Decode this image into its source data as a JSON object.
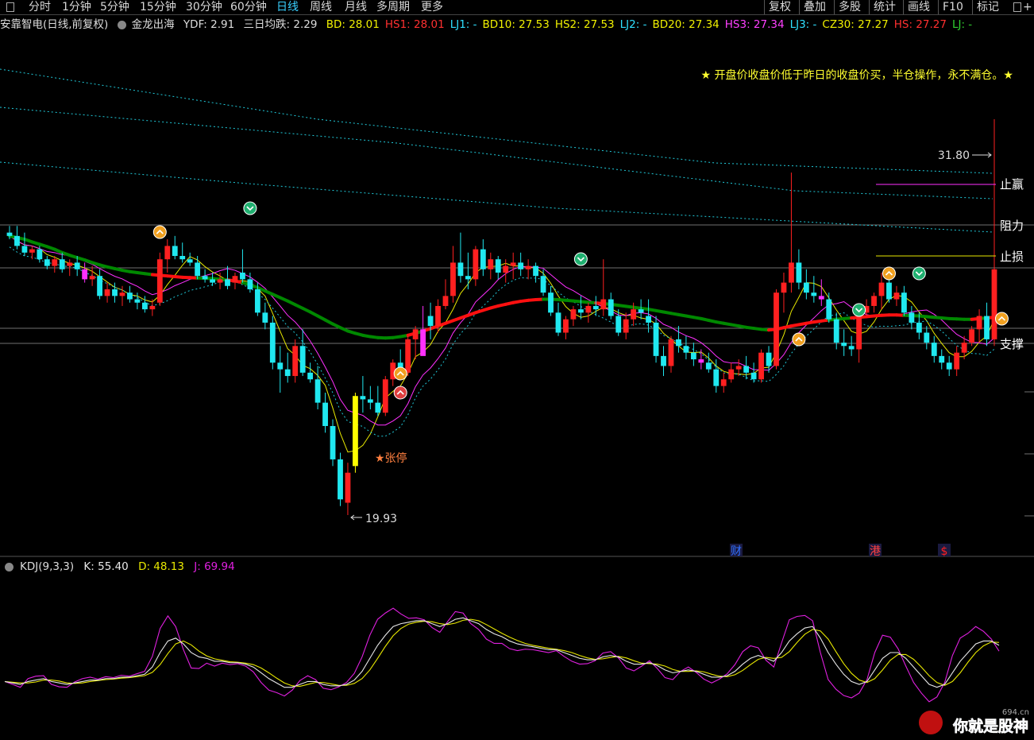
{
  "toolbar": {
    "tabs": [
      "分时",
      "1分钟",
      "5分钟",
      "15分钟",
      "30分钟",
      "60分钟",
      "日线",
      "周线",
      "月线",
      "多周期",
      "更多"
    ],
    "active_tab": "日线",
    "right_buttons": [
      "复权",
      "叠加",
      "多股",
      "统计",
      "画线",
      "F10",
      "标记",
      "+自选"
    ]
  },
  "info": {
    "stock": "安靠智电(日线,前复权)",
    "indicator": "金龙出海",
    "ydf_label": "YDF:",
    "ydf_value": "2.91",
    "sanri_label": "三日均跌:",
    "sanri_value": "2.29",
    "items": [
      {
        "text": "BD: 28.01",
        "color": "#f0f000"
      },
      {
        "text": "HS1: 28.01",
        "color": "#ff3030"
      },
      {
        "text": "LJ1: -",
        "color": "#30e0ff"
      },
      {
        "text": "BD10: 27.53",
        "color": "#f0f000"
      },
      {
        "text": "HS2: 27.53",
        "color": "#f0f000"
      },
      {
        "text": "LJ2: -",
        "color": "#30e0ff"
      },
      {
        "text": "BD20: 27.34",
        "color": "#f0f000"
      },
      {
        "text": "HS3: 27.34",
        "color": "#ff40ff"
      },
      {
        "text": "LJ3: -",
        "color": "#30e0ff"
      },
      {
        "text": "CZ30: 27.27",
        "color": "#f0f000"
      },
      {
        "text": "HS: 27.27",
        "color": "#ff3030"
      },
      {
        "text": "LJ: -",
        "color": "#30d030"
      }
    ],
    "strategy_note": "★ 开盘价收盘价低于昨日的收盘价买，半仓操作，永不满仓。★"
  },
  "kdj": {
    "name": "KDJ(9,3,3)",
    "k_text": "K: 55.40",
    "d_text": "D: 48.13",
    "j_text": "J: 69.94",
    "colors": {
      "k": "#e8e8e8",
      "d": "#e8e800",
      "j": "#e020e0"
    }
  },
  "colors": {
    "up": "#ff2020",
    "down": "#20e8f0",
    "limit_up": "#ffff00",
    "ma_green": "#008800",
    "ma_red": "#ff1010",
    "pink": "#ff30ff",
    "bg": "#000000",
    "grid": "#707070"
  },
  "chart_data": {
    "type": "candlestick",
    "annotations": {
      "high_label": "31.80",
      "low_label": "19.93",
      "limit_up_label": "★张停",
      "stop_profit_label": "止赢",
      "resistance_label": "阻力",
      "stop_loss_label": "止损",
      "support_label": "支撑",
      "event_marks": [
        "财",
        "港",
        "$"
      ],
      "watermark": "你就是股神",
      "watermark_site": "694.cn"
    },
    "price_range": [
      19.2,
      32.6
    ],
    "candles": [
      [
        28.4,
        28.6,
        28.2,
        28.3
      ],
      [
        28.3,
        28.6,
        27.9,
        28.0
      ],
      [
        28.0,
        28.4,
        27.7,
        27.8
      ],
      [
        27.8,
        28.0,
        27.6,
        27.9
      ],
      [
        27.9,
        28.0,
        27.5,
        27.6
      ],
      [
        27.6,
        27.7,
        27.3,
        27.4
      ],
      [
        27.4,
        27.7,
        27.2,
        27.6
      ],
      [
        27.6,
        27.8,
        27.2,
        27.3
      ],
      [
        27.4,
        27.6,
        27.1,
        27.5
      ],
      [
        27.5,
        27.7,
        27.1,
        27.3
      ],
      [
        27.3,
        27.5,
        26.9,
        27.0
      ],
      [
        27.0,
        27.4,
        26.8,
        27.1
      ],
      [
        27.1,
        27.3,
        26.4,
        26.5
      ],
      [
        26.5,
        26.9,
        26.3,
        26.7
      ],
      [
        26.7,
        26.9,
        26.3,
        26.5
      ],
      [
        26.5,
        26.8,
        26.2,
        26.6
      ],
      [
        26.6,
        26.8,
        26.3,
        26.4
      ],
      [
        26.4,
        26.6,
        26.1,
        26.3
      ],
      [
        26.3,
        26.5,
        26.0,
        26.1
      ],
      [
        26.1,
        26.4,
        25.9,
        26.2
      ],
      [
        26.3,
        27.8,
        26.2,
        27.6
      ],
      [
        27.6,
        28.2,
        27.2,
        28.0
      ],
      [
        28.0,
        28.3,
        27.6,
        27.7
      ],
      [
        27.7,
        28.1,
        27.5,
        27.6
      ],
      [
        27.6,
        27.8,
        27.4,
        27.5
      ],
      [
        27.5,
        27.7,
        27.0,
        27.1
      ],
      [
        27.1,
        27.3,
        26.9,
        27.0
      ],
      [
        27.0,
        27.2,
        26.8,
        26.9
      ],
      [
        26.9,
        27.2,
        26.7,
        27.0
      ],
      [
        27.0,
        27.4,
        26.7,
        26.8
      ],
      [
        26.9,
        27.2,
        26.7,
        27.1
      ],
      [
        27.2,
        27.9,
        26.9,
        27.0
      ],
      [
        27.0,
        27.2,
        26.6,
        26.7
      ],
      [
        26.7,
        26.9,
        25.9,
        26.0
      ],
      [
        26.0,
        26.3,
        25.5,
        25.7
      ],
      [
        25.7,
        25.9,
        24.3,
        24.5
      ],
      [
        24.5,
        25.0,
        23.6,
        24.3
      ],
      [
        24.3,
        24.8,
        23.9,
        24.1
      ],
      [
        24.1,
        25.2,
        23.9,
        25.0
      ],
      [
        25.0,
        25.5,
        24.1,
        24.2
      ],
      [
        24.2,
        24.5,
        23.9,
        24.0
      ],
      [
        24.0,
        24.4,
        23.1,
        23.3
      ],
      [
        23.3,
        23.6,
        22.4,
        22.6
      ],
      [
        22.6,
        22.8,
        21.4,
        21.6
      ],
      [
        21.6,
        21.8,
        20.2,
        20.4
      ],
      [
        20.3,
        21.5,
        19.93,
        21.2
      ],
      [
        21.4,
        23.6,
        21.2,
        23.5
      ],
      [
        23.5,
        24.1,
        23.0,
        23.4
      ],
      [
        23.4,
        23.8,
        23.1,
        23.3
      ],
      [
        23.3,
        23.8,
        22.9,
        23.0
      ],
      [
        23.0,
        24.1,
        22.9,
        24.0
      ],
      [
        24.0,
        24.6,
        23.8,
        24.5
      ],
      [
        24.5,
        24.9,
        24.0,
        24.2
      ],
      [
        24.2,
        25.3,
        24.1,
        25.2
      ],
      [
        25.2,
        25.6,
        24.6,
        25.5
      ],
      [
        25.5,
        26.2,
        25.1,
        24.7
      ],
      [
        25.9,
        26.3,
        25.2,
        25.6
      ],
      [
        25.6,
        26.4,
        25.4,
        26.2
      ],
      [
        26.2,
        27.0,
        26.1,
        26.5
      ],
      [
        26.5,
        28.0,
        26.3,
        27.5
      ],
      [
        27.5,
        28.4,
        26.9,
        27.1
      ],
      [
        27.1,
        27.8,
        26.7,
        27.0
      ],
      [
        27.0,
        28.0,
        26.8,
        27.9
      ],
      [
        27.9,
        28.2,
        27.1,
        27.3
      ],
      [
        27.3,
        27.8,
        27.0,
        27.6
      ],
      [
        27.6,
        27.7,
        27.0,
        27.2
      ],
      [
        27.2,
        27.6,
        26.9,
        27.4
      ],
      [
        27.4,
        27.8,
        27.0,
        27.5
      ],
      [
        27.5,
        27.8,
        27.1,
        27.3
      ],
      [
        27.3,
        27.6,
        27.0,
        27.4
      ],
      [
        27.4,
        27.5,
        26.9,
        27.1
      ],
      [
        27.1,
        27.3,
        26.5,
        26.6
      ],
      [
        26.6,
        26.8,
        25.9,
        26.0
      ],
      [
        26.0,
        26.3,
        25.3,
        25.4
      ],
      [
        25.4,
        25.9,
        25.2,
        25.8
      ],
      [
        25.8,
        26.2,
        25.6,
        26.1
      ],
      [
        26.1,
        26.5,
        25.8,
        26.0
      ],
      [
        26.0,
        26.3,
        25.7,
        26.2
      ],
      [
        26.2,
        26.5,
        25.9,
        26.1
      ],
      [
        26.1,
        27.6,
        25.9,
        26.4
      ],
      [
        26.4,
        26.6,
        25.8,
        25.9
      ],
      [
        25.9,
        26.1,
        25.3,
        25.4
      ],
      [
        25.4,
        26.0,
        25.2,
        25.8
      ],
      [
        25.8,
        26.3,
        25.6,
        26.1
      ],
      [
        26.1,
        26.4,
        25.8,
        26.0
      ],
      [
        25.9,
        26.4,
        25.4,
        25.7
      ],
      [
        25.7,
        25.9,
        24.5,
        24.7
      ],
      [
        24.7,
        25.0,
        24.1,
        24.4
      ],
      [
        24.4,
        25.3,
        24.2,
        25.2
      ],
      [
        25.2,
        25.6,
        24.8,
        25.0
      ],
      [
        25.0,
        25.3,
        24.6,
        24.8
      ],
      [
        24.8,
        25.1,
        24.4,
        24.6
      ],
      [
        24.6,
        24.9,
        24.3,
        24.5
      ],
      [
        24.5,
        24.8,
        24.2,
        24.3
      ],
      [
        24.3,
        24.6,
        23.6,
        23.8
      ],
      [
        23.8,
        24.2,
        23.6,
        24.0
      ],
      [
        24.0,
        24.5,
        23.9,
        24.3
      ],
      [
        24.3,
        24.6,
        24.1,
        24.4
      ],
      [
        24.4,
        24.7,
        24.0,
        24.2
      ],
      [
        24.2,
        24.5,
        23.9,
        24.0
      ],
      [
        24.0,
        24.9,
        23.9,
        24.8
      ],
      [
        24.8,
        25.0,
        24.2,
        24.4
      ],
      [
        24.4,
        26.7,
        24.3,
        26.6
      ],
      [
        26.6,
        27.2,
        26.0,
        26.9
      ],
      [
        26.9,
        30.2,
        26.6,
        27.5
      ],
      [
        27.5,
        27.9,
        26.7,
        26.9
      ],
      [
        26.9,
        27.3,
        26.4,
        26.6
      ],
      [
        26.6,
        27.1,
        26.3,
        26.5
      ],
      [
        26.5,
        27.0,
        26.2,
        26.4
      ],
      [
        26.4,
        26.6,
        25.7,
        25.8
      ],
      [
        25.8,
        26.0,
        24.9,
        25.1
      ],
      [
        25.1,
        25.5,
        24.7,
        25.0
      ],
      [
        25.0,
        25.3,
        24.7,
        24.9
      ],
      [
        24.9,
        26.2,
        24.5,
        26.0
      ],
      [
        26.0,
        26.4,
        25.9,
        26.2
      ],
      [
        26.2,
        26.6,
        26.0,
        26.5
      ],
      [
        26.5,
        27.2,
        26.1,
        26.9
      ],
      [
        26.9,
        27.0,
        26.3,
        26.4
      ],
      [
        26.4,
        26.8,
        26.2,
        26.6
      ],
      [
        26.6,
        26.8,
        25.9,
        26.0
      ],
      [
        26.0,
        26.2,
        25.5,
        25.7
      ],
      [
        25.7,
        26.0,
        25.2,
        25.4
      ],
      [
        25.4,
        25.6,
        24.9,
        25.1
      ],
      [
        25.1,
        25.3,
        24.5,
        24.7
      ],
      [
        24.7,
        24.9,
        24.3,
        24.5
      ],
      [
        24.5,
        24.7,
        24.1,
        24.3
      ],
      [
        24.3,
        25.0,
        24.1,
        24.8
      ],
      [
        24.8,
        25.3,
        24.6,
        25.1
      ],
      [
        25.1,
        25.6,
        25.0,
        25.5
      ],
      [
        25.5,
        26.1,
        25.1,
        25.9
      ],
      [
        25.9,
        26.3,
        25.0,
        25.2
      ],
      [
        25.2,
        31.8,
        25.0,
        27.3
      ]
    ],
    "ma_thick": [
      28.3,
      28.25,
      28.2,
      28.12,
      28.05,
      27.98,
      27.9,
      27.8,
      27.72,
      27.65,
      27.58,
      27.5,
      27.43,
      27.37,
      27.32,
      27.27,
      27.23,
      27.2,
      27.17,
      27.14,
      27.12,
      27.1,
      27.08,
      27.06,
      27.05,
      27.04,
      27.03,
      27.02,
      27.0,
      26.98,
      26.95,
      26.9,
      26.83,
      26.75,
      26.65,
      26.55,
      26.45,
      26.35,
      26.24,
      26.13,
      26.02,
      25.9,
      25.78,
      25.66,
      25.55,
      25.45,
      25.38,
      25.32,
      25.28,
      25.25,
      25.24,
      25.25,
      25.28,
      25.32,
      25.38,
      25.45,
      25.52,
      25.6,
      25.68,
      25.76,
      25.84,
      25.92,
      26.0,
      26.07,
      26.14,
      26.2,
      26.25,
      26.3,
      26.34,
      26.37,
      26.39,
      26.4,
      26.4,
      26.39,
      26.37,
      26.35,
      26.33,
      26.31,
      26.29,
      26.27,
      26.25,
      26.22,
      26.19,
      26.16,
      26.13,
      26.1,
      26.06,
      26.02,
      25.98,
      25.94,
      25.9,
      25.86,
      25.82,
      25.77,
      25.72,
      25.68,
      25.64,
      25.6,
      25.56,
      25.53,
      25.5,
      25.48,
      25.5,
      25.55,
      25.6,
      25.64,
      25.68,
      25.72,
      25.75,
      25.78,
      25.8,
      25.82,
      25.84,
      25.86,
      25.88,
      25.9,
      25.92,
      25.93,
      25.93,
      25.92,
      25.91,
      25.9,
      25.88,
      25.86,
      25.84,
      25.82,
      25.81,
      25.8,
      25.8,
      25.82,
      25.84,
      25.86
    ],
    "kdj_values": {
      "k": [
        30,
        29,
        28,
        30,
        31,
        32,
        30,
        29,
        28,
        29,
        30,
        31,
        31,
        32,
        32,
        33,
        33,
        34,
        35,
        40,
        50,
        58,
        60,
        56,
        50,
        47,
        46,
        44,
        44,
        43,
        43,
        42,
        40,
        36,
        32,
        29,
        26,
        26,
        28,
        30,
        30,
        28,
        27,
        27,
        28,
        31,
        37,
        46,
        55,
        62,
        68,
        70,
        71,
        72,
        72,
        70,
        68,
        70,
        73,
        74,
        72,
        70,
        66,
        63,
        61,
        58,
        56,
        55,
        54,
        53,
        52,
        52,
        50,
        48,
        46,
        45,
        45,
        47,
        48,
        47,
        44,
        42,
        42,
        43,
        41,
        38,
        36,
        37,
        38,
        37,
        35,
        33,
        33,
        34,
        37,
        42,
        46,
        48,
        46,
        44,
        50,
        58,
        63,
        67,
        68,
        60,
        50,
        42,
        35,
        30,
        28,
        30,
        38,
        46,
        50,
        50,
        46,
        40,
        34,
        28,
        26,
        28,
        36,
        44,
        50,
        56,
        58,
        58,
        55
      ]
    },
    "kdj_range": [
      0,
      100
    ]
  }
}
